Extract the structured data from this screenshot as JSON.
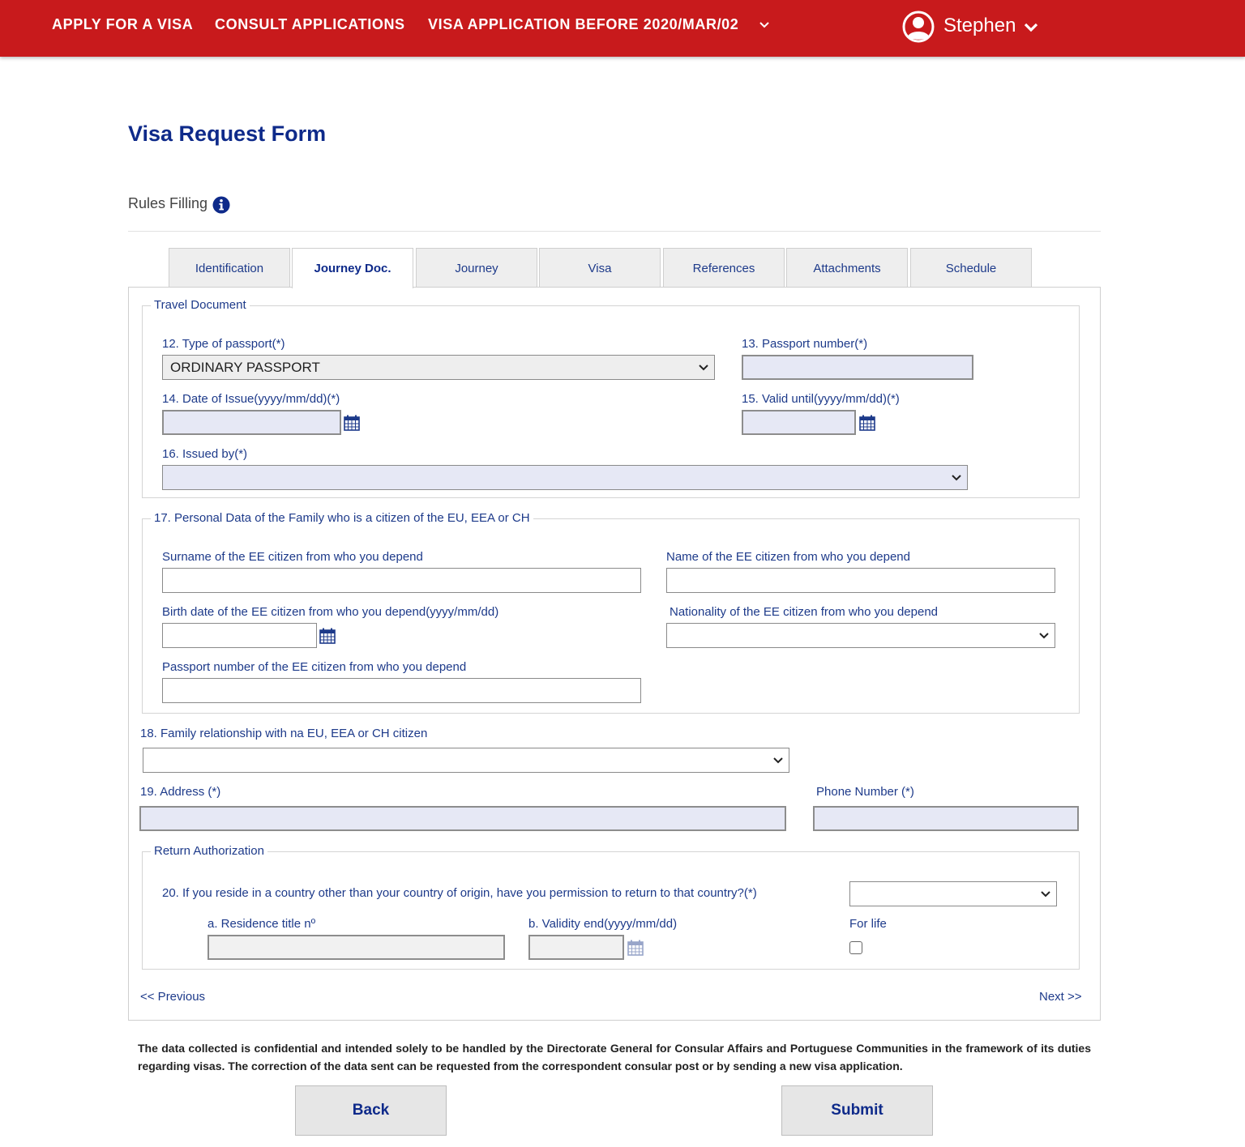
{
  "nav": {
    "apply": "APPLY FOR A VISA",
    "consult": "CONSULT APPLICATIONS",
    "before": "VISA APPLICATION BEFORE 2020/MAR/02"
  },
  "user": {
    "name": "Stephen"
  },
  "page": {
    "title": "Visa Request Form",
    "rules": "Rules Filling"
  },
  "tabs": [
    {
      "label": "Identification"
    },
    {
      "label": "Journey Doc."
    },
    {
      "label": "Journey"
    },
    {
      "label": "Visa"
    },
    {
      "label": "References"
    },
    {
      "label": "Attachments"
    },
    {
      "label": "Schedule"
    }
  ],
  "active_tab": "Journey Doc.",
  "travel_document": {
    "legend": "Travel Document",
    "type_label": "12. Type of passport(*)",
    "type_value": "ORDINARY PASSPORT",
    "number_label": "13. Passport number(*)",
    "issue_label": "14. Date of Issue(yyyy/mm/dd)(*)",
    "valid_label": "15. Valid until(yyyy/mm/dd)(*)",
    "issued_by_label": "16. Issued by(*)"
  },
  "family": {
    "legend": "17. Personal Data of the Family who is a citizen of the EU, EEA or CH",
    "surname_label": "Surname of the EE citizen from who you depend",
    "name_label": "Name of the EE citizen from who you depend",
    "birth_label": "Birth date of the EE citizen from who you depend(yyyy/mm/dd)",
    "nationality_label": "Nationality of the EE citizen from who you depend",
    "passport_label": "Passport number of the EE citizen from who you depend"
  },
  "relationship_label": "18. Family relationship with na EU, EEA or CH citizen",
  "address_label": "19. Address (*)",
  "phone_label": "Phone Number (*)",
  "return_auth": {
    "legend": "Return Authorization",
    "question": "20. If you reside in a country other than your country of origin, have you permission to return to that country?(*)",
    "residence_label": "a. Residence title nº",
    "validity_label": "b. Validity end(yyyy/mm/dd)",
    "for_life_label": "For life"
  },
  "pager": {
    "previous": "<< Previous",
    "next": "Next >>"
  },
  "notice": "The data collected is confidential and intended solely to be handled by the Directorate General for Consular Affairs and Portuguese Communities in the framework of its duties regarding visas. The correction of the data sent can be requested from the correspondent consular post or by sending a new visa application.",
  "buttons": {
    "back": "Back",
    "submit": "Submit"
  },
  "colors": {
    "brand_red": "#c81a1c",
    "link_blue": "#1d3a8a",
    "required_bg": "#e6e8f5"
  }
}
